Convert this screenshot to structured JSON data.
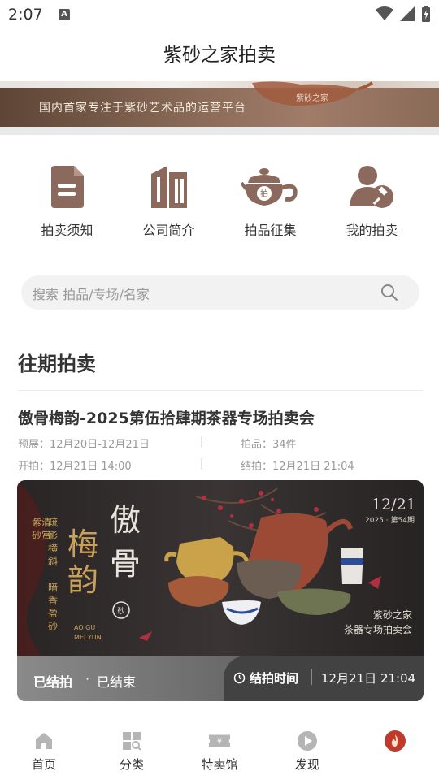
{
  "status_bar": {
    "time": "2:07",
    "notification_badge": "A"
  },
  "header": {
    "title": "紫砂之家拍卖"
  },
  "banner": {
    "text": "国内首家专注于紫砂艺术品的运营平台",
    "watermark": "紫砂之家"
  },
  "quick_menu": [
    {
      "label": "拍卖须知",
      "icon": "notice-doc-icon"
    },
    {
      "label": "公司简介",
      "icon": "building-icon"
    },
    {
      "label": "拍品征集",
      "icon": "teapot-icon"
    },
    {
      "label": "我的拍卖",
      "icon": "user-gavel-icon"
    }
  ],
  "search": {
    "placeholder": "搜索 拍品/专场/名家"
  },
  "section": {
    "title": "往期拍卖"
  },
  "auction": {
    "title": "傲骨梅韵-2025第伍拾肆期茶器专场拍卖会",
    "preview_label": "预展：12月20日-12月21日",
    "lots_label": "拍品：34件",
    "start_label": "开拍：12月21日 14:00",
    "end_label": "结拍：12月21日 21:04",
    "separator": "|",
    "poster": {
      "date": "12/21",
      "issue": "2025 · 第54期",
      "calligraphy_main_1": "梅韵",
      "calligraphy_main_2": "傲骨",
      "vertical_1": "紫砂清赏",
      "vertical_2": "疏影横斜",
      "vertical_3": "暗香盈砂",
      "seal": "紫砂",
      "pinyin_1": "AO GU",
      "pinyin_2": "MEI YUN",
      "org_line_1": "紫砂之家",
      "org_line_2": "茶器专场拍卖会"
    },
    "status": "已结拍",
    "dot": "·",
    "status_state": "已结束",
    "end_time_label": "结拍时间",
    "end_time_value": "12月21日 21:04"
  },
  "bottom_nav": [
    {
      "label": "首页",
      "icon": "home-icon"
    },
    {
      "label": "分类",
      "icon": "category-icon"
    },
    {
      "label": "特卖馆",
      "icon": "ticket-icon"
    },
    {
      "label": "发现",
      "icon": "play-icon"
    },
    {
      "label": "",
      "icon": "fire-icon"
    }
  ],
  "colors": {
    "icon_brown": "#8b6a5d",
    "nav_grey": "#b5b5b5",
    "accent_red": "#c0392b"
  }
}
